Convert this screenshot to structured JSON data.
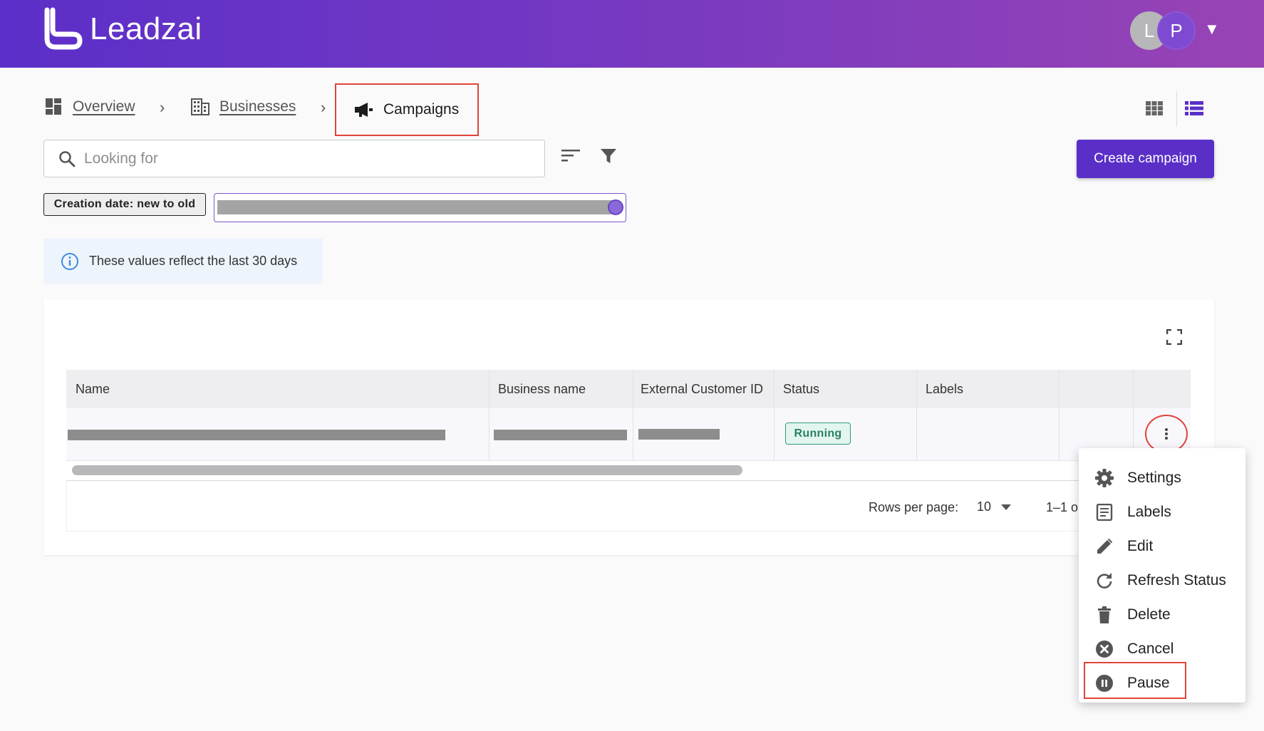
{
  "app": {
    "name": "Leadzai"
  },
  "user": {
    "avatars": [
      "L",
      "P"
    ],
    "menu_caret": "▼"
  },
  "breadcrumb": {
    "items": [
      {
        "label": "Overview",
        "icon": "dashboard-icon"
      },
      {
        "label": "Businesses",
        "icon": "building-icon"
      },
      {
        "label": "Campaigns",
        "icon": "megaphone-icon"
      }
    ],
    "separator": "›"
  },
  "search": {
    "placeholder": "Looking for",
    "value": ""
  },
  "actions": {
    "create_label": "Create campaign"
  },
  "filters": {
    "sort_chip": "Creation date: new to old",
    "filter_chip": "[redacted]"
  },
  "info": {
    "text": "These values reflect the last 30 days"
  },
  "table": {
    "columns": [
      "Name",
      "Business name",
      "External Customer ID",
      "Status",
      "Labels",
      ""
    ],
    "rows": [
      {
        "name": "[redacted]",
        "business_name": "[redacted]",
        "external_customer_id": "[redacted]",
        "status": "Running",
        "labels": ""
      }
    ],
    "footer": {
      "rows_per_page_label": "Rows per page:",
      "rows_per_page_value": "10",
      "range": "1–1 o"
    }
  },
  "row_menu": {
    "items": [
      {
        "label": "Settings",
        "icon": "gear-icon"
      },
      {
        "label": "Labels",
        "icon": "labels-icon"
      },
      {
        "label": "Edit",
        "icon": "pencil-icon"
      },
      {
        "label": "Refresh Status",
        "icon": "refresh-icon"
      },
      {
        "label": "Delete",
        "icon": "trash-icon"
      },
      {
        "label": "Cancel",
        "icon": "cancel-icon"
      },
      {
        "label": "Pause",
        "icon": "pause-icon"
      }
    ]
  },
  "colors": {
    "brand": "#5a2fc8",
    "highlight": "#e0443a",
    "status_running": "#2f9b7d"
  }
}
